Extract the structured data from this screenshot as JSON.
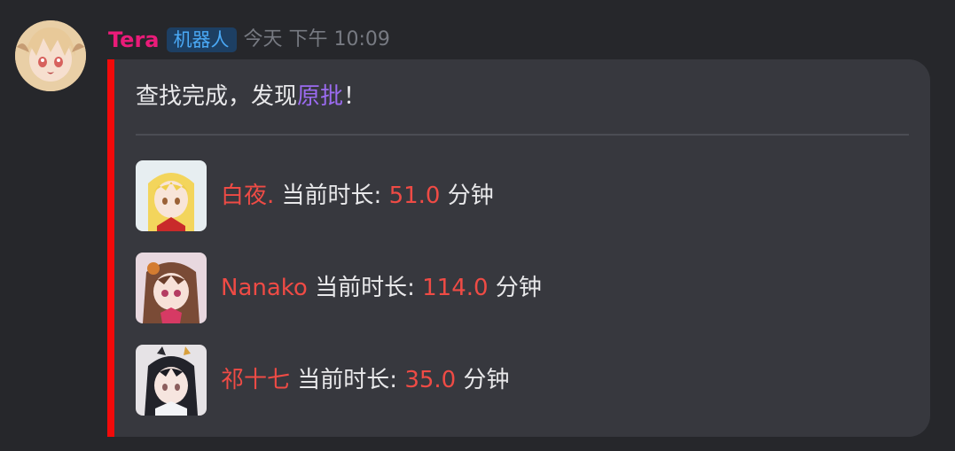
{
  "message": {
    "username": "Tera",
    "badge": "机器人",
    "timestamp": "今天 下午 10:09"
  },
  "embed": {
    "description_prefix": "查找完成，发现",
    "description_highlight": "原批",
    "description_suffix": "！",
    "label": "当前时长:",
    "unit": "分钟",
    "entries": [
      {
        "name": "白夜.",
        "duration": "51.0"
      },
      {
        "name": "Nanako",
        "duration": "114.0"
      },
      {
        "name": "祁十七",
        "duration": "35.0"
      }
    ]
  },
  "colors": {
    "username": "#ea1b79",
    "accent_bar": "#f20a0a",
    "highlight": "#9b6bf0",
    "value_red": "#ef4b45"
  }
}
